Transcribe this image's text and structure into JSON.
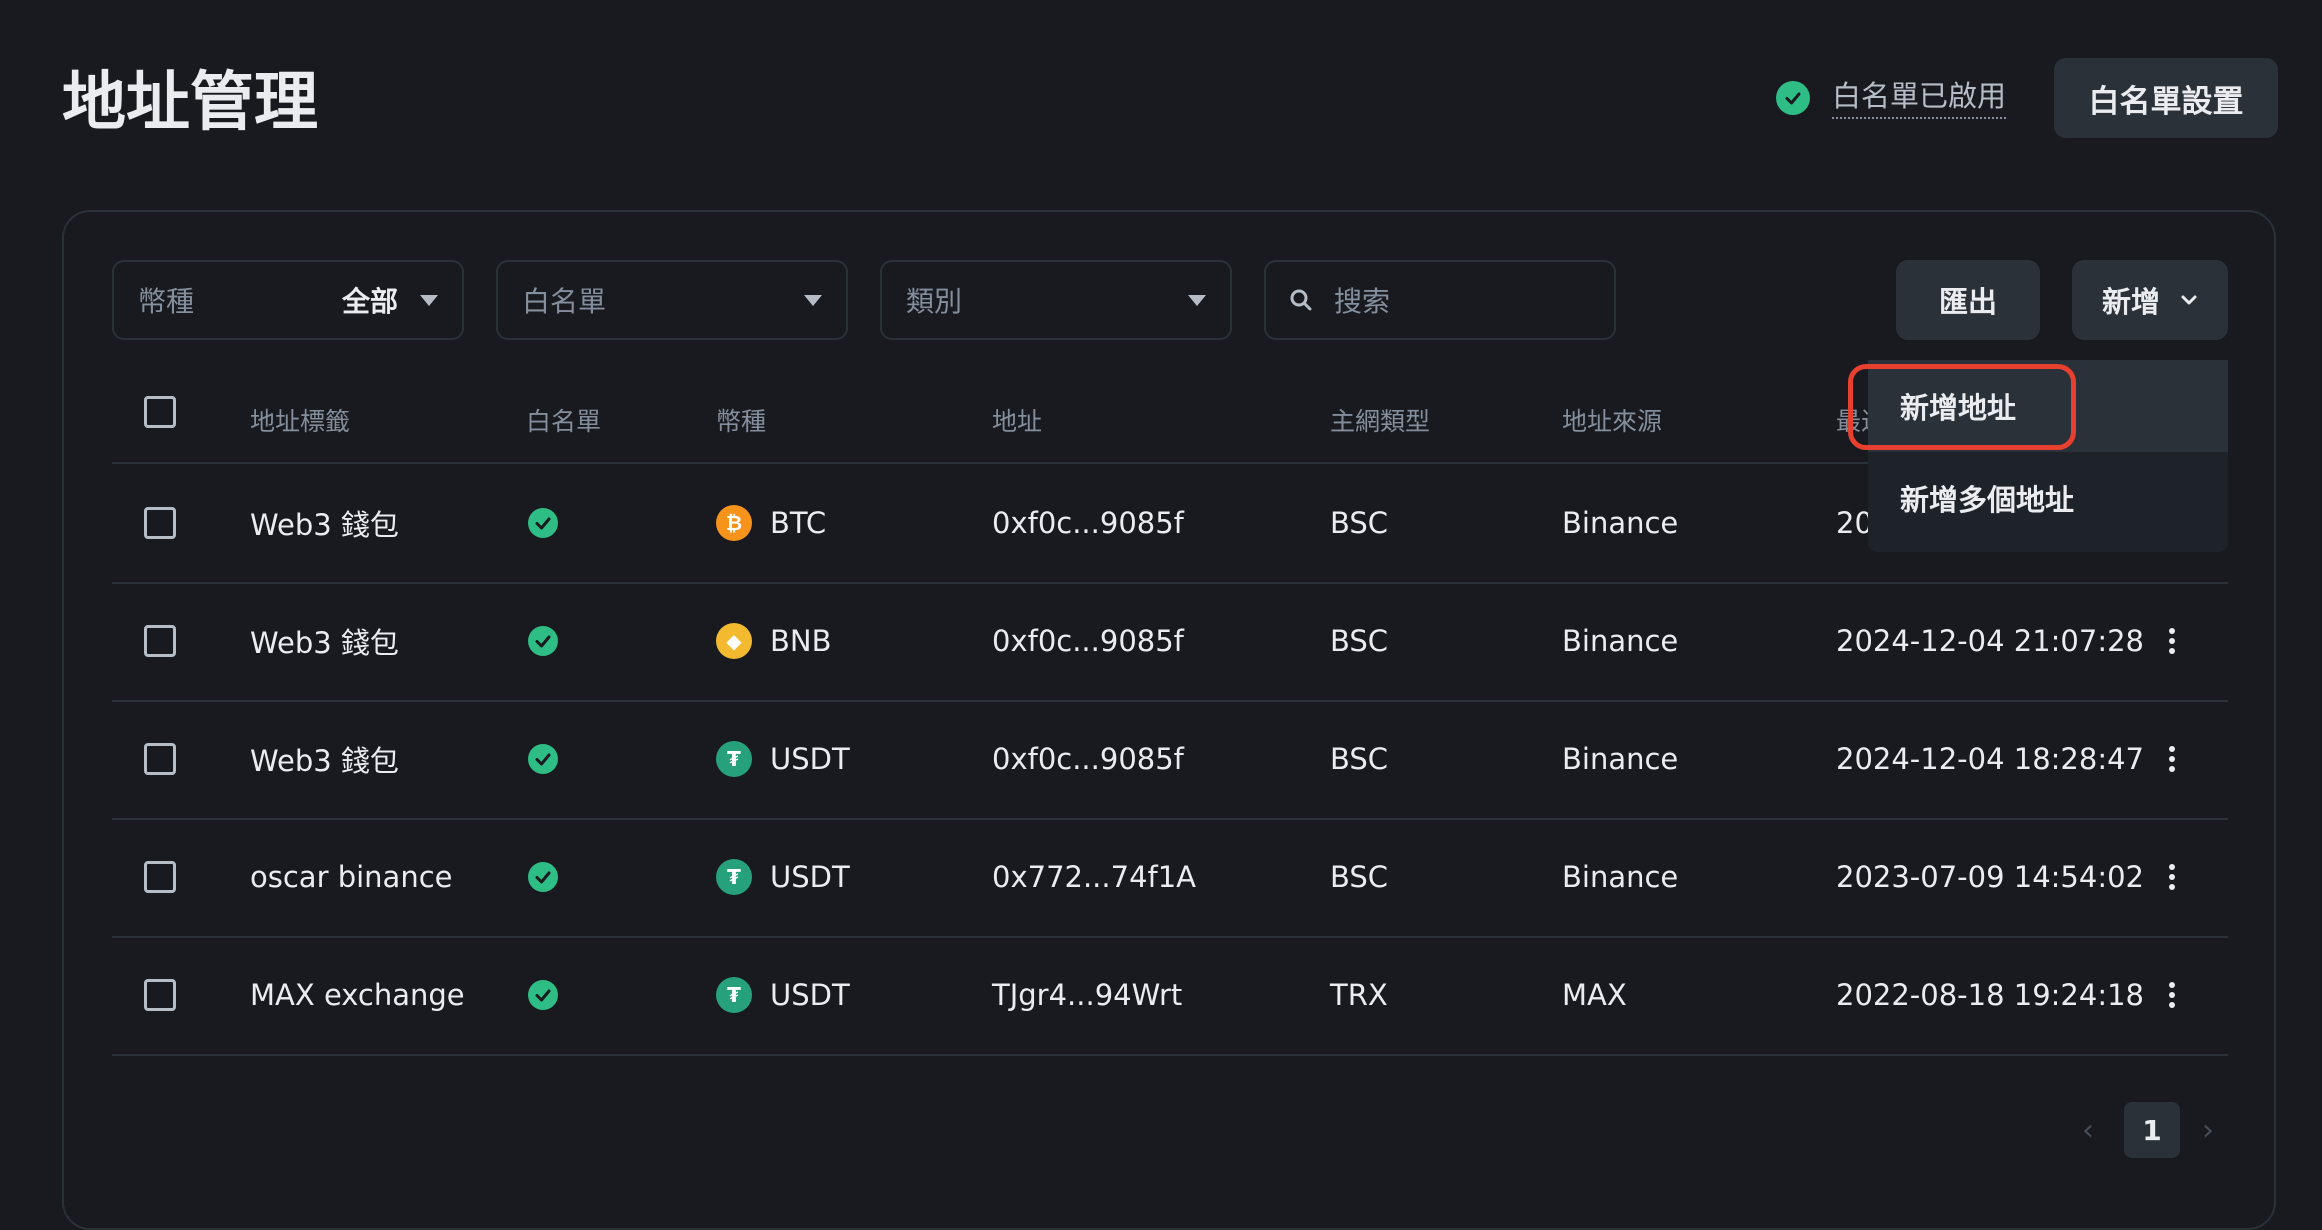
{
  "page": {
    "title": "地址管理"
  },
  "whitelist": {
    "status_label": "白名單已啟用",
    "settings_label": "白名單設置"
  },
  "filters": {
    "coin": {
      "label": "幣種",
      "value": "全部"
    },
    "whitelist": {
      "label": "白名單"
    },
    "category": {
      "label": "類別"
    },
    "search": {
      "placeholder": "搜索"
    }
  },
  "actions": {
    "export_label": "匯出",
    "add_label": "新增"
  },
  "add_menu": {
    "items": [
      "新增地址",
      "新增多個地址"
    ]
  },
  "table": {
    "headers": [
      "地址標籤",
      "白名單",
      "幣種",
      "地址",
      "主網類型",
      "地址來源",
      "最近"
    ],
    "rows": [
      {
        "label": "Web3 錢包",
        "coin": "BTC",
        "address": "0xf0c...9085f",
        "network": "BSC",
        "source": "Binance",
        "time": "20"
      },
      {
        "label": "Web3 錢包",
        "coin": "BNB",
        "address": "0xf0c...9085f",
        "network": "BSC",
        "source": "Binance",
        "time": "2024-12-04 21:07:28"
      },
      {
        "label": "Web3 錢包",
        "coin": "USDT",
        "address": "0xf0c...9085f",
        "network": "BSC",
        "source": "Binance",
        "time": "2024-12-04 18:28:47"
      },
      {
        "label": "oscar binance",
        "coin": "USDT",
        "address": "0x772...74f1A",
        "network": "BSC",
        "source": "Binance",
        "time": "2023-07-09 14:54:02"
      },
      {
        "label": "MAX exchange",
        "coin": "USDT",
        "address": "TJgr4...94Wrt",
        "network": "TRX",
        "source": "MAX",
        "time": "2022-08-18 19:24:18"
      }
    ]
  },
  "pagination": {
    "current": "1",
    "prev": "‹",
    "next": "›"
  },
  "colors": {
    "bg": "#181a20",
    "success": "#2ebd85",
    "btc": "#f7931a",
    "bnb": "#f3ba2f",
    "usdt": "#26a17b",
    "highlight": "#e8402f"
  }
}
